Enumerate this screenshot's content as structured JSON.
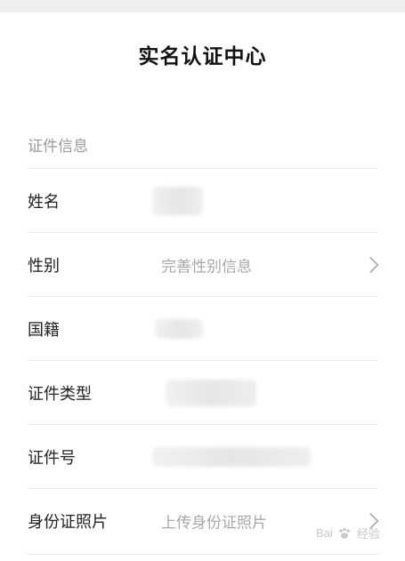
{
  "page": {
    "title": "实名认证中心",
    "section_label": "证件信息"
  },
  "rows": [
    {
      "label": "姓名",
      "value": ""
    },
    {
      "label": "性别",
      "value": "完善性别信息"
    },
    {
      "label": "国籍",
      "value": ""
    },
    {
      "label": "证件类型",
      "value": ""
    },
    {
      "label": "证件号",
      "value": ""
    },
    {
      "label": "身份证照片",
      "value": "上传身份证照片"
    }
  ],
  "watermark": {
    "text_left": "Bai",
    "text_right": "经验"
  },
  "colors": {
    "title": "#111111",
    "label": "#222222",
    "placeholder": "#a8a8a8",
    "divider": "#e8e8e8"
  }
}
